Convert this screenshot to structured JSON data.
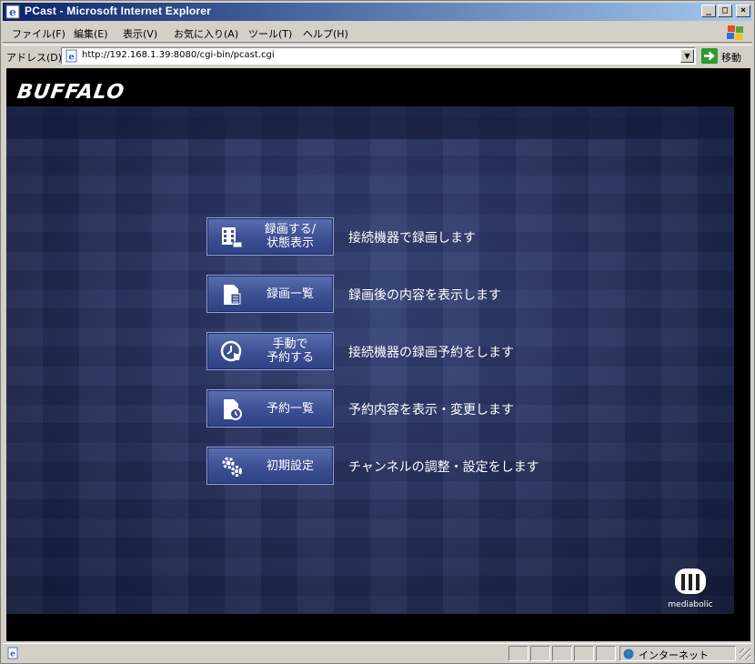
{
  "window": {
    "title": "PCast - Microsoft Internet Explorer",
    "minimize_glyph": "_",
    "maximize_glyph": "□",
    "close_glyph": "×"
  },
  "menubar": {
    "items": [
      {
        "label": "ファイル(F)"
      },
      {
        "label": "編集(E)"
      },
      {
        "label": "表示(V)"
      },
      {
        "label": "お気に入り(A)"
      },
      {
        "label": "ツール(T)"
      },
      {
        "label": "ヘルプ(H)"
      }
    ]
  },
  "address": {
    "label": "アドレス(D)",
    "url": "http://192.168.1.39:8080/cgi-bin/pcast.cgi",
    "go_label": "移動"
  },
  "page": {
    "logo": "BUFFALO",
    "menu": [
      {
        "label": "録画する/\n状態表示",
        "description": "接続機器で録画します",
        "icon": "record-film-icon"
      },
      {
        "label": "録画一覧",
        "description": "録画後の内容を表示します",
        "icon": "document-list-icon"
      },
      {
        "label": "手動で\n予約する",
        "description": "接続機器の録画予約をします",
        "icon": "clock-hand-icon"
      },
      {
        "label": "予約一覧",
        "description": "予約内容を表示・変更します",
        "icon": "document-clock-icon"
      },
      {
        "label": "初期設定",
        "description": "チャンネルの調整・設定をします",
        "icon": "gears-icon"
      }
    ],
    "footer_logo": "mediabolic"
  },
  "statusbar": {
    "zone": "インターネット"
  },
  "colors": {
    "titlebar_start": "#0a246a",
    "button_face": "#3b4f92",
    "background": "#1a2248"
  }
}
